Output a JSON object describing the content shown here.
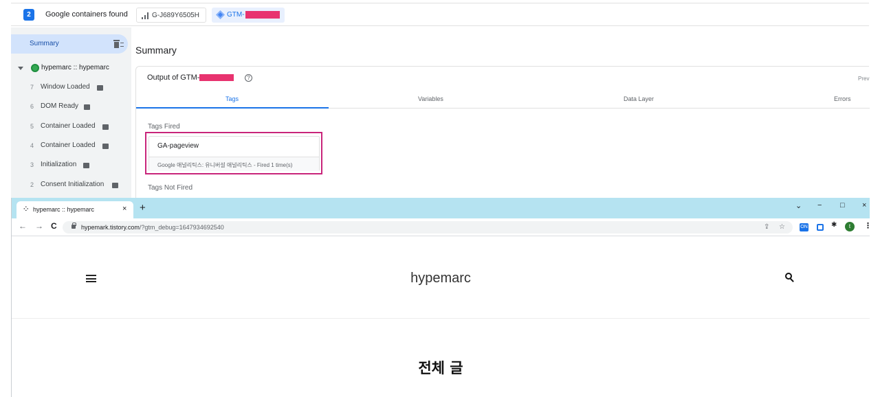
{
  "tag_assistant": {
    "container_count": "2",
    "containers_label": "Google containers found",
    "ga_chip": "G-J689Y6505H",
    "gtm_chip": "GTM-",
    "sidebar": {
      "summary_label": "Summary",
      "site_label": "hypemarc :: hypemarc",
      "events": [
        {
          "num": "7",
          "label": "Window Loaded"
        },
        {
          "num": "6",
          "label": "DOM Ready"
        },
        {
          "num": "5",
          "label": "Container Loaded"
        },
        {
          "num": "4",
          "label": "Container Loaded"
        },
        {
          "num": "3",
          "label": "Initialization"
        },
        {
          "num": "2",
          "label": "Consent Initialization"
        }
      ]
    },
    "main": {
      "title": "Summary",
      "output_title": "Output of GTM-",
      "preview_text": "Prev",
      "tabs": [
        "Tags",
        "Variables",
        "Data Layer",
        "Errors"
      ],
      "tags_fired_label": "Tags Fired",
      "fired_tag": {
        "name": "GA-pageview",
        "detail": "Google 애널리틱스: 유니버설 애널리틱스 - Fired 1 time(s)"
      },
      "tags_not_fired_label": "Tags Not Fired"
    },
    "colors": {
      "accent": "#1a73e8",
      "highlight_border": "#c8247a",
      "redaction": "#e8336f",
      "status_green": "#34a853"
    }
  },
  "browser": {
    "tab_title": "hypemarc :: hypemarc",
    "tab_close": "×",
    "new_tab": "+",
    "window_controls": [
      "⌄",
      "−",
      "□",
      "×"
    ],
    "nav": {
      "back": "←",
      "forward": "→",
      "reload": "C"
    },
    "url_host": "hypemark.tistory.com",
    "url_path": "/?gtm_debug=1647934692540",
    "profile_initial": "t",
    "ext_badge": "ON",
    "tabstrip_color": "#b5e3f1"
  },
  "page": {
    "site_title": "hypemarc",
    "heading": "전체 글"
  }
}
